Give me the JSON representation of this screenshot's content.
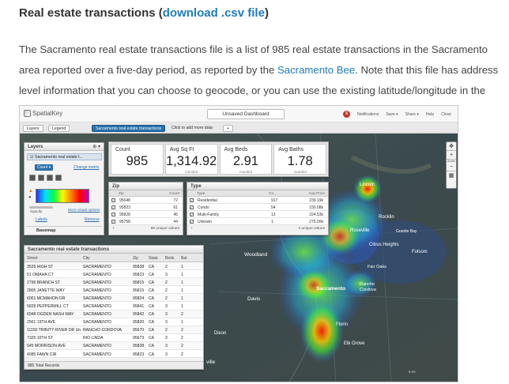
{
  "heading": {
    "title": "Real estate transactions",
    "open_paren": " (",
    "link": "download .csv file",
    "close_paren": ")"
  },
  "description": {
    "text1": "The Sacramento real estate transactions file is a list of 985 real estate transactions in the Sacramento area reported over a five-day period, as reported by the ",
    "link": "Sacramento Bee",
    "text2": ". Note that this file has address level information that you can choose to geocode, or you can use the existing latitude/longitude in the file."
  },
  "app": {
    "brand": "SpatialKey",
    "dashboard_title": "Unsaved Dashboard",
    "notif_count": "5",
    "top_menu": [
      "Notifications",
      "Save ▾",
      "Share ▾",
      "Help",
      "Close"
    ],
    "toolbar": {
      "layers": "Layers",
      "legend": "Legend",
      "active_tab": "Sacramento real estate transactions",
      "add_more": "Click to add more data",
      "plus": "+"
    }
  },
  "layers_panel": {
    "title": "Layers",
    "layer_name": "Sacramento real estate t...",
    "count_badge": "Count ▾",
    "change_metric": "Change metric",
    "opacity": "Opacity",
    "more_visual": "More visual options",
    "labels": "Labels",
    "remove": "Remove",
    "basemap": "Basemap"
  },
  "stats": [
    {
      "label": "Count",
      "value": "985",
      "sub": ""
    },
    {
      "label": "Avg Sq Ft",
      "value": "1,314.92",
      "sub": "rounded"
    },
    {
      "label": "Avg Beds",
      "value": "2.91",
      "sub": "rounded"
    },
    {
      "label": "Avg Baths",
      "value": "1.78",
      "sub": "rounded"
    }
  ],
  "zip_widget": {
    "title": "Zip",
    "columns": [
      "Zip",
      "Count"
    ],
    "rows": [
      {
        "zip": "95648",
        "count": "72"
      },
      {
        "zip": "95823",
        "count": "61"
      },
      {
        "zip": "95828",
        "count": "45"
      },
      {
        "zip": "95758",
        "count": "44"
      }
    ],
    "footer": "68 unique values"
  },
  "type_widget": {
    "title": "Type",
    "columns": [
      "Type",
      "Co...",
      "Avg Price"
    ],
    "rows": [
      {
        "type": "Residential",
        "count": "917",
        "avg": "239.19k"
      },
      {
        "type": "Condo",
        "count": "54",
        "avg": "150.08k"
      },
      {
        "type": "Multi-Family",
        "count": "13",
        "avg": "224.53k"
      },
      {
        "type": "Unkown",
        "count": "1",
        "avg": "275.00k"
      }
    ],
    "footer": "4 unique values"
  },
  "table": {
    "title": "Sacramento real estate transactions",
    "columns": [
      "Street",
      "City",
      "Zip",
      "State",
      "Beds",
      "Bat"
    ],
    "rows": [
      [
        "3526 HIGH ST",
        "SACRAMENTO",
        "95838",
        "CA",
        "2",
        "1"
      ],
      [
        "51 OMAHA CT",
        "SACRAMENTO",
        "95823",
        "CA",
        "3",
        "1"
      ],
      [
        "2796 BRANCH ST",
        "SACRAMENTO",
        "95815",
        "CA",
        "2",
        "1"
      ],
      [
        "2805 JANETTE WAY",
        "SACRAMENTO",
        "95815",
        "CA",
        "2",
        "1"
      ],
      [
        "6001 MCMAHON DR",
        "SACRAMENTO",
        "95824",
        "CA",
        "2",
        "1"
      ],
      [
        "5828 PEPPERMILL CT",
        "SACRAMENTO",
        "95841",
        "CA",
        "3",
        "1"
      ],
      [
        "6048 OGDEN NASH WAY",
        "SACRAMENTO",
        "95842",
        "CA",
        "3",
        "2"
      ],
      [
        "2561 19TH AVE",
        "SACRAMENTO",
        "95820",
        "CA",
        "3",
        "1"
      ],
      [
        "11150 TRINITY RIVER DR Un",
        "RANCHO CORDOVA",
        "95670",
        "CA",
        "2",
        "2"
      ],
      [
        "7325 10TH ST",
        "RIO LINDA",
        "95673",
        "CA",
        "3",
        "2"
      ],
      [
        "645 MORRISON AVE",
        "SACRAMENTO",
        "95838",
        "CA",
        "3",
        "2"
      ],
      [
        "4085 FAWN CIR",
        "SACRAMENTO",
        "95823",
        "CA",
        "3",
        "2"
      ]
    ],
    "footer": "985 Total Records"
  },
  "map": {
    "places": [
      "Lincoln",
      "Rocklin",
      "Roseville",
      "Granite Bay",
      "Citrus Heights",
      "Folsom",
      "Fair Oaks",
      "Woodland",
      "Davis",
      "Sacramento",
      "Rancho Cordova",
      "Florin",
      "Elk Grove",
      "Dixon",
      "ville"
    ],
    "zoom_label": "Zoom",
    "scale": "5 mi"
  },
  "colors": {
    "accent": "#2a6ea8",
    "link": "#1f7bb8",
    "heat_hot": "#ff0000"
  }
}
